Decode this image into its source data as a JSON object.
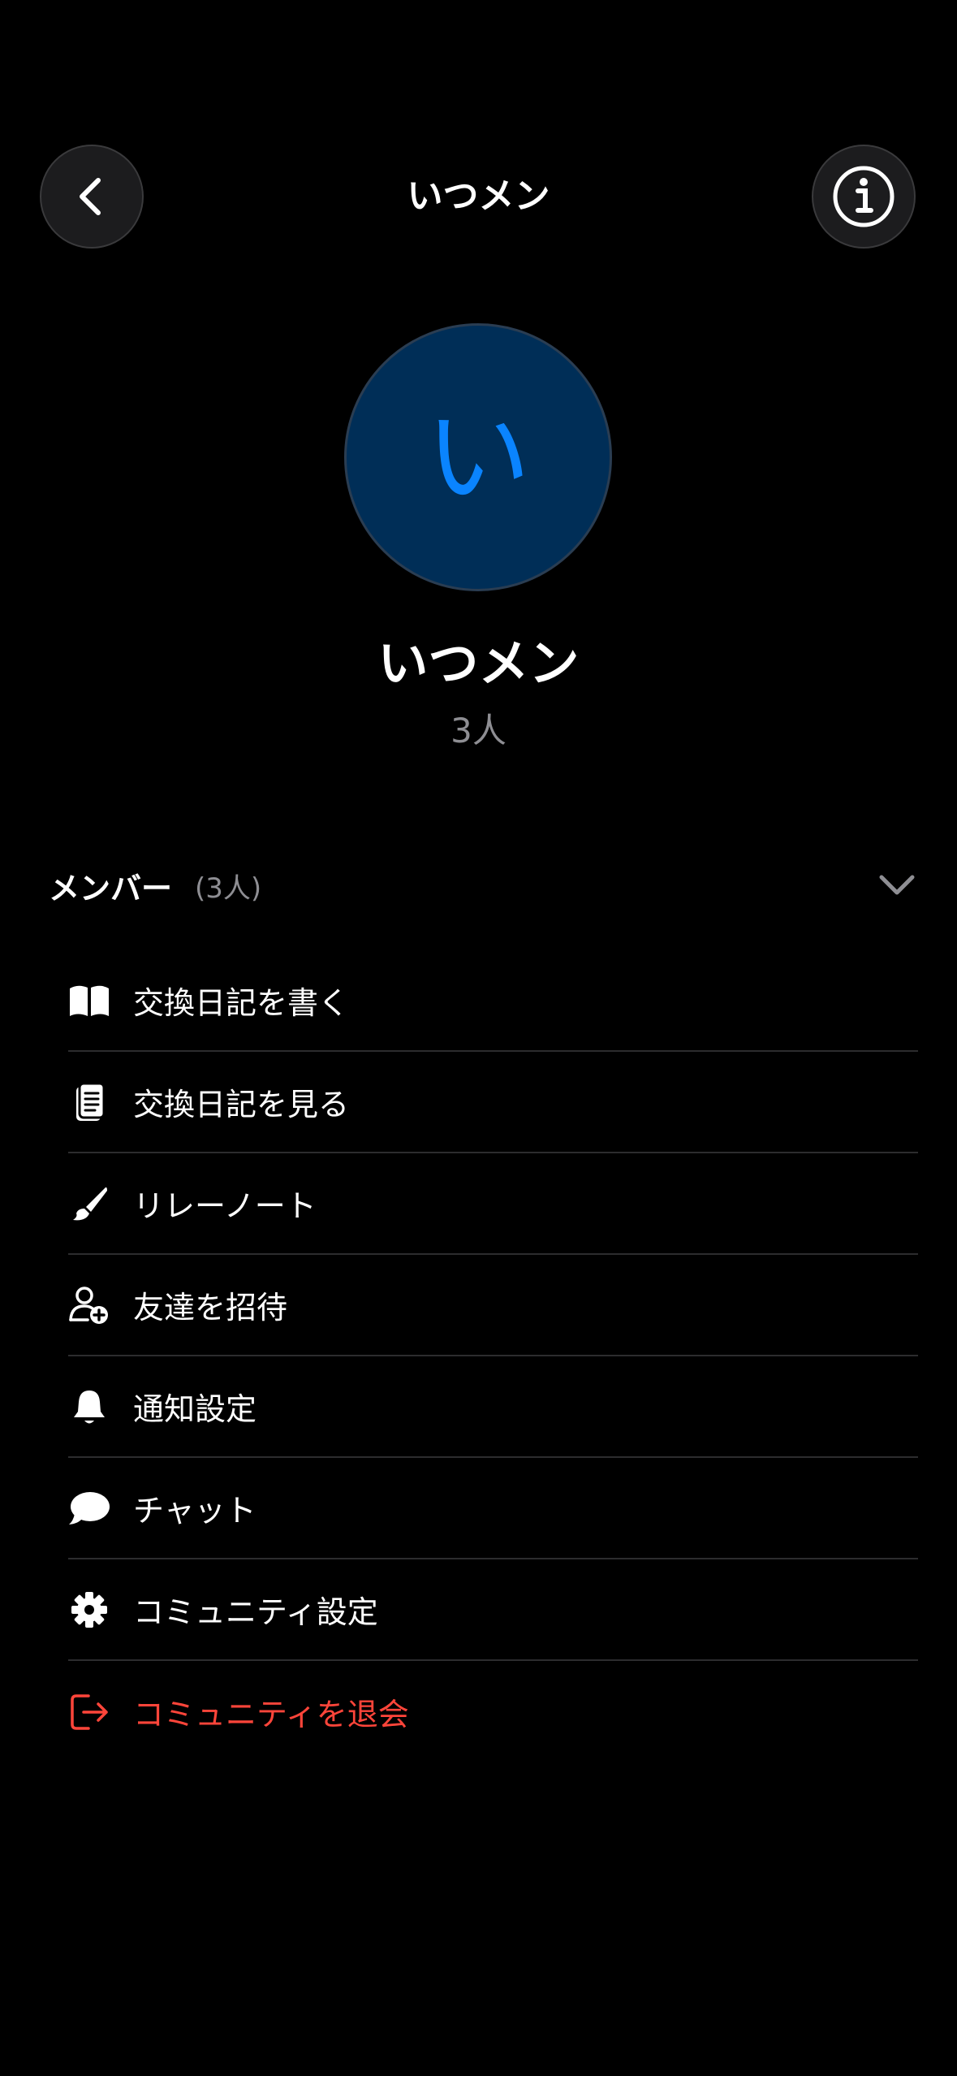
{
  "header": {
    "title": "いつメン",
    "back_icon": "chevron-left-icon",
    "info_icon": "info-icon"
  },
  "community": {
    "avatar_letter": "い",
    "name": "いつメン",
    "member_count": "3人"
  },
  "members": {
    "title": "メンバー",
    "count": "(3人)"
  },
  "menu": [
    {
      "label": "交換日記を書く",
      "icon": "book-open-icon"
    },
    {
      "label": "交換日記を見る",
      "icon": "notebook-icon"
    },
    {
      "label": "リレーノート",
      "icon": "brush-icon"
    },
    {
      "label": "友達を招待",
      "icon": "person-add-icon"
    },
    {
      "label": "通知設定",
      "icon": "bell-icon"
    },
    {
      "label": "チャット",
      "icon": "chat-bubble-icon"
    },
    {
      "label": "コミュニティ設定",
      "icon": "gear-icon"
    },
    {
      "label": "コミュニティを退会",
      "icon": "exit-icon"
    }
  ],
  "colors": {
    "background": "#000000",
    "accent": "#0a84ff",
    "avatar_bg": "#002e57",
    "danger": "#ff453a",
    "secondary_text": "#8e8e93"
  }
}
